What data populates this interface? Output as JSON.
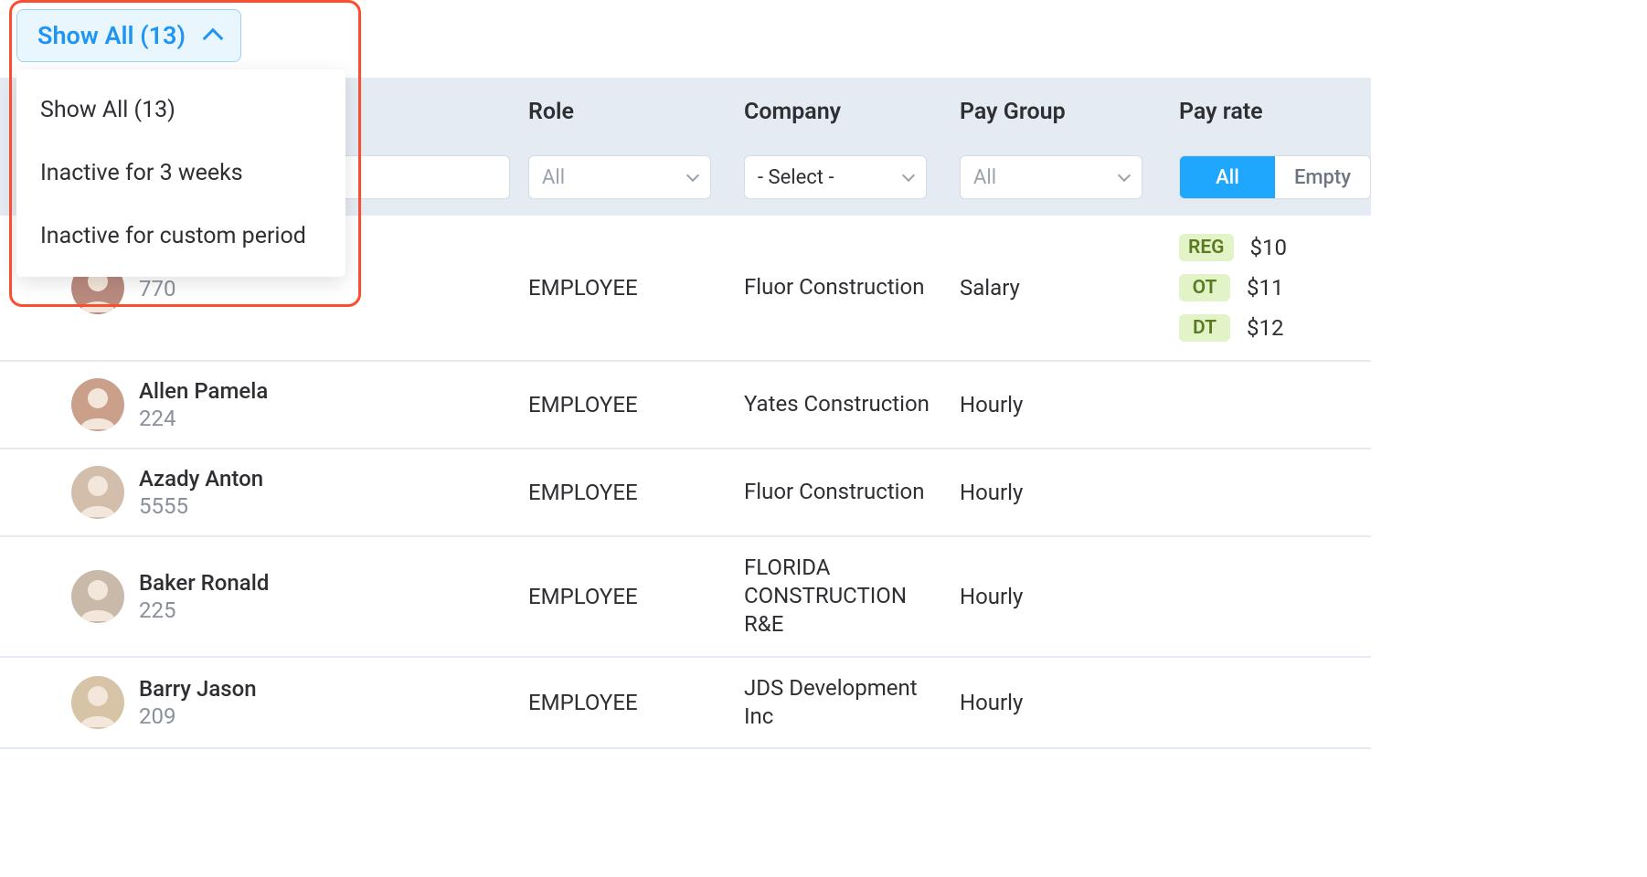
{
  "filter_button": {
    "label": "Show All (13)"
  },
  "dropdown_options": [
    "Show All (13)",
    "Inactive for 3 weeks",
    "Inactive for custom period"
  ],
  "headers": {
    "role": "Role",
    "company": "Company",
    "pay_group": "Pay Group",
    "pay_rate": "Pay rate"
  },
  "filters": {
    "role_placeholder": "All",
    "company_value": "- Select -",
    "paygroup_placeholder": "All",
    "payrate_all": "All",
    "payrate_empty": "Empty"
  },
  "rows": [
    {
      "name": "",
      "id": "770",
      "role": "EMPLOYEE",
      "company": "Fluor Construction",
      "pay_group": "Salary",
      "avatar_bg": "#b98a7e",
      "rates": [
        {
          "badge": "REG",
          "amount": "$10"
        },
        {
          "badge": "OT",
          "amount": "$11"
        },
        {
          "badge": "DT",
          "amount": "$12"
        }
      ]
    },
    {
      "name": "Allen Pamela",
      "id": "224",
      "role": "EMPLOYEE",
      "company": "Yates Construction",
      "pay_group": "Hourly",
      "avatar_bg": "#caa08a",
      "rates": []
    },
    {
      "name": "Azady Anton",
      "id": "5555",
      "role": "EMPLOYEE",
      "company": "Fluor Construction",
      "pay_group": "Hourly",
      "avatar_bg": "#d3beab",
      "rates": []
    },
    {
      "name": "Baker Ronald",
      "id": "225",
      "role": "EMPLOYEE",
      "company": "FLORIDA CONSTRUCTION R&E",
      "pay_group": "Hourly",
      "avatar_bg": "#c9b9a8",
      "rates": []
    },
    {
      "name": "Barry Jason",
      "id": "209",
      "role": "EMPLOYEE",
      "company": "JDS Development Inc",
      "pay_group": "Hourly",
      "avatar_bg": "#d7c3a6",
      "rates": []
    }
  ]
}
